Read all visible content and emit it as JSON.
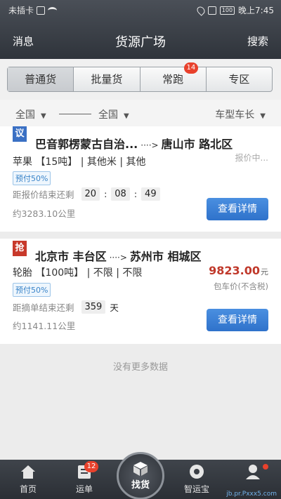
{
  "status_bar": {
    "carrier": "未插卡",
    "battery": "100",
    "time": "晚上7:45"
  },
  "header": {
    "left": "消息",
    "title": "货源广场",
    "right": "搜索"
  },
  "tabs": [
    {
      "label": "普通货",
      "active": true
    },
    {
      "label": "批量货"
    },
    {
      "label": "常跑",
      "badge": "14"
    },
    {
      "label": "专区"
    }
  ],
  "filters": {
    "from": "全国",
    "to": "全国",
    "vehicle": "车型车长"
  },
  "cards": [
    {
      "tag": "议",
      "route_from": "巴音郭楞蒙古自治...",
      "arrow": "····>",
      "route_to": "唐山市 路北区",
      "goods": "苹果 【15吨】 | 其他米 | 其他",
      "prepay": "预付50%",
      "remain_label": "距报价结束还剩",
      "time_h": "20",
      "time_m": "08",
      "time_s": "49",
      "distance": "约3283.10公里",
      "quote_status": "报价中...",
      "button": "查看详情"
    },
    {
      "tag": "抢",
      "route_from": "北京市 丰台区",
      "arrow": "····>",
      "route_to": "苏州市 相城区",
      "goods": "轮胎 【100吨】 | 不限 | 不限",
      "prepay": "预付50%",
      "remain_label": "距摘单结束还剩",
      "days": "359",
      "days_unit": "天",
      "distance": "约1141.11公里",
      "price": "9823.00",
      "price_unit": "元",
      "price_type": "包车价(不含税)",
      "button": "查看详情"
    }
  ],
  "no_more": "没有更多数据",
  "bottom_nav": {
    "home": "首页",
    "orders": "运单",
    "orders_badge": "12",
    "find": "找货",
    "wallet": "智运宝",
    "profile": ""
  },
  "watermark": "jb.pr.Pxxx5.com"
}
